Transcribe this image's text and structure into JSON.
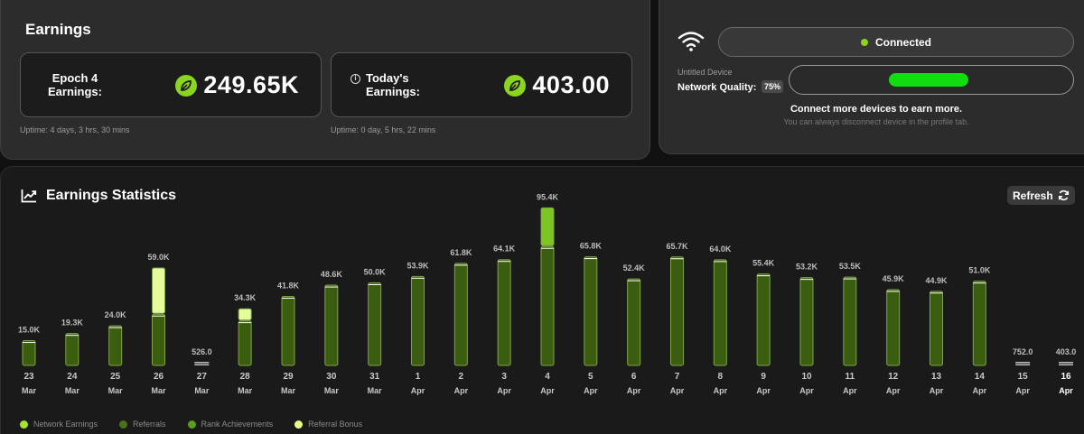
{
  "earnings": {
    "title": "Earnings",
    "epoch_card": {
      "label_line1": "Epoch 4",
      "label_line2": "Earnings:",
      "value": "249.65K",
      "uptime": "Uptime: 4 days, 3 hrs, 30 mins"
    },
    "today_card": {
      "info_icon": "i",
      "label_line1": "Today's",
      "label_line2": "Earnings:",
      "value": "403.00",
      "uptime": "Uptime: 0 day, 5 hrs, 22 mins"
    }
  },
  "device": {
    "status": "Connected",
    "device_name": "Untitled Device",
    "network_quality_label": "Network Quality:",
    "network_quality_value": "75%",
    "connect_title": "Connect more devices to earn more.",
    "connect_subtitle": "You can always disconnect device in the profile tab."
  },
  "stats": {
    "title": "Earnings Statistics",
    "refresh_label": "Refresh"
  },
  "legend": [
    {
      "label": "Network Earnings",
      "color": "#a6e22e"
    },
    {
      "label": "Referrals",
      "color": "#4b6f1a"
    },
    {
      "label": "Rank Achievements",
      "color": "#5d9e22"
    },
    {
      "label": "Referral Bonus",
      "color": "#e9fd8a"
    }
  ],
  "colors": {
    "bar_fill": "#3b5d10",
    "bar_outline": "#7fa24a",
    "bonus_fill": "#e6fb9a",
    "accent": "#8bd41f"
  },
  "chart_data": {
    "type": "bar",
    "categories": [
      "23 Mar",
      "24 Mar",
      "25 Mar",
      "26 Mar",
      "27 Mar",
      "28 Mar",
      "29 Mar",
      "30 Mar",
      "31 Mar",
      "1 Apr",
      "2 Apr",
      "3 Apr",
      "4 Apr",
      "5 Apr",
      "6 Apr",
      "7 Apr",
      "8 Apr",
      "9 Apr",
      "10 Apr",
      "11 Apr",
      "12 Apr",
      "13 Apr",
      "14 Apr",
      "15 Apr",
      "16 Apr"
    ],
    "day_labels": [
      "23",
      "24",
      "25",
      "26",
      "27",
      "28",
      "29",
      "30",
      "31",
      "1",
      "2",
      "3",
      "4",
      "5",
      "6",
      "7",
      "8",
      "9",
      "10",
      "11",
      "12",
      "13",
      "14",
      "15",
      "16"
    ],
    "month_labels": [
      "Mar",
      "Mar",
      "Mar",
      "Mar",
      "Mar",
      "Mar",
      "Mar",
      "Mar",
      "Mar",
      "Apr",
      "Apr",
      "Apr",
      "Apr",
      "Apr",
      "Apr",
      "Apr",
      "Apr",
      "Apr",
      "Apr",
      "Apr",
      "Apr",
      "Apr",
      "Apr",
      "Apr",
      "Apr"
    ],
    "value_labels": [
      "15.0K",
      "19.3K",
      "24.0K",
      "59.0K",
      "526.0",
      "34.3K",
      "41.8K",
      "48.6K",
      "50.0K",
      "53.9K",
      "61.8K",
      "64.1K",
      "95.4K",
      "65.8K",
      "52.4K",
      "65.7K",
      "64.0K",
      "55.4K",
      "53.2K",
      "53.5K",
      "45.9K",
      "44.9K",
      "51.0K",
      "752.0",
      "403.0"
    ],
    "values": [
      15000,
      19300,
      24000,
      59000,
      526,
      34300,
      41800,
      48600,
      50000,
      53900,
      61800,
      64100,
      95400,
      65800,
      52400,
      65700,
      64000,
      55400,
      53200,
      53500,
      45900,
      44900,
      51000,
      752,
      403
    ],
    "series": [
      {
        "name": "Network Earnings",
        "values": [
          15000,
          19300,
          24000,
          31000,
          526,
          27000,
          41800,
          48600,
          50000,
          53900,
          61800,
          64100,
          72000,
          65800,
          52400,
          65700,
          64000,
          55400,
          53200,
          53500,
          45900,
          44900,
          51000,
          752,
          403
        ]
      },
      {
        "name": "Referral Bonus",
        "values": [
          0,
          0,
          0,
          28000,
          0,
          7300,
          0,
          0,
          0,
          0,
          0,
          0,
          23400,
          0,
          0,
          0,
          0,
          0,
          0,
          0,
          0,
          0,
          0,
          0,
          0
        ]
      }
    ],
    "highlighted_index": 24,
    "ylim": [
      0,
      100000
    ]
  }
}
